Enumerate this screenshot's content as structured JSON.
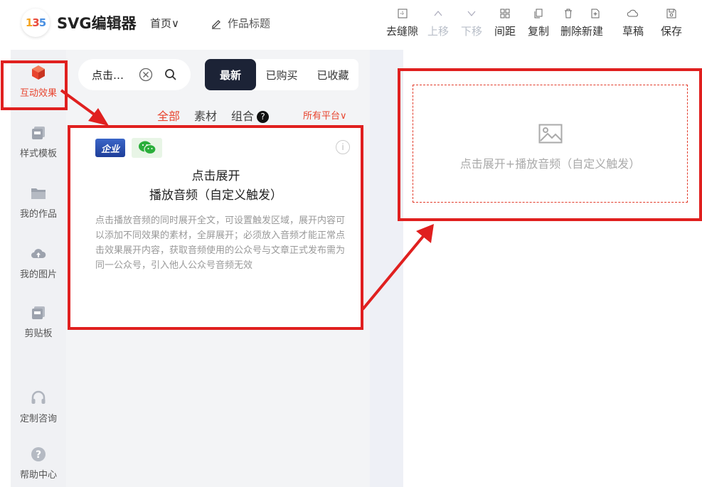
{
  "header": {
    "app_title": "SVG编辑器",
    "logo_text": [
      "1",
      "3",
      "5"
    ],
    "nav_home": "首页∨",
    "work_title": "作品标题",
    "toolbar": [
      {
        "label": "去缝隙",
        "icon": "gap-remove-icon",
        "enabled": true
      },
      {
        "label": "上移",
        "icon": "move-up-icon",
        "enabled": false
      },
      {
        "label": "下移",
        "icon": "move-down-icon",
        "enabled": false
      },
      {
        "label": "间距",
        "icon": "spacing-icon",
        "enabled": true
      },
      {
        "label": "复制",
        "icon": "copy-icon",
        "enabled": true
      },
      {
        "label": "删除新建",
        "icon": "delete-new-icon",
        "enabled": true
      },
      {
        "label": "草稿",
        "icon": "cloud-draft-icon",
        "enabled": true
      },
      {
        "label": "保存",
        "icon": "save-icon",
        "enabled": true
      }
    ]
  },
  "sidebar": {
    "items": [
      {
        "label": "互动效果",
        "icon": "cube-icon",
        "active": true
      },
      {
        "label": "样式模板",
        "icon": "template-icon",
        "active": false
      },
      {
        "label": "我的作品",
        "icon": "folder-icon",
        "active": false
      },
      {
        "label": "我的图片",
        "icon": "cloud-upload-icon",
        "active": false
      },
      {
        "label": "剪贴板",
        "icon": "clipboard-icon",
        "active": false
      },
      {
        "label": "定制咨询",
        "icon": "headset-icon",
        "active": false
      },
      {
        "label": "帮助中心",
        "icon": "help-icon",
        "active": false
      }
    ]
  },
  "panel": {
    "search": {
      "value": "点击…"
    },
    "filter_tabs": [
      {
        "label": "最新",
        "active": true
      },
      {
        "label": "已购买",
        "active": false
      },
      {
        "label": "已收藏",
        "active": false
      }
    ],
    "category_tabs": [
      {
        "label": "全部",
        "active": true
      },
      {
        "label": "素材",
        "active": false
      },
      {
        "label": "组合",
        "active": false
      }
    ],
    "combo_help": "?",
    "platform": "所有平台∨",
    "card": {
      "badge_enterprise": "企业",
      "info": "i",
      "title_line1": "点击展开",
      "title_line2": "播放音频（自定义触发）",
      "description": "点击播放音频的同时展开全文，可设置触发区域，展开内容可以添加不同效果的素材，全屏展开；必须放入音频才能正常点击效果展开内容，获取音频使用的公众号与文章正式发布需为同一公众号，引入他人公众号音频无效"
    }
  },
  "canvas": {
    "block_text": "点击展开+播放音频（自定义触发）"
  },
  "colors": {
    "accent": "#e8452f",
    "annotation": "#e0201f",
    "dark_tab": "#1c2336"
  }
}
